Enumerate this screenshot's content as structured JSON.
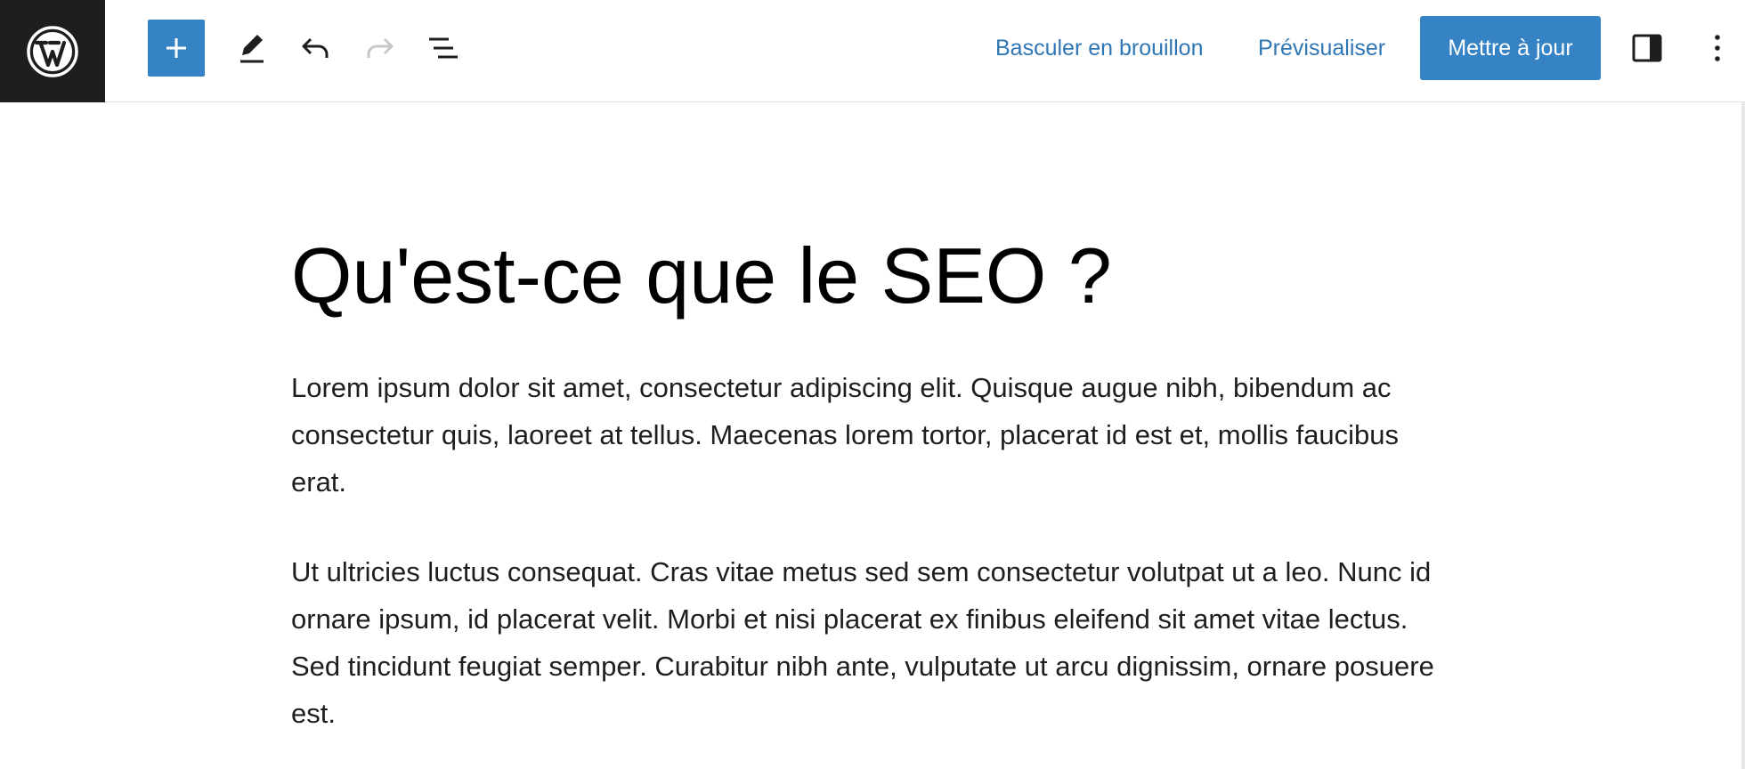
{
  "toolbar": {
    "add_block_label": "+",
    "switch_to_draft": "Basculer en brouillon",
    "preview": "Prévisualiser",
    "update": "Mettre à jour"
  },
  "icons": {
    "logo": "wordpress-logo",
    "add": "plus-icon",
    "tools": "pencil-icon",
    "undo": "undo-icon",
    "redo": "redo-icon",
    "list_view": "list-view-icon",
    "settings": "sidebar-toggle-icon",
    "options": "more-vertical-icon"
  },
  "colors": {
    "accent": "#3582c4",
    "link": "#2f76b5",
    "logo_bg": "#1e1e1e",
    "disabled": "#c7c7c7"
  },
  "post": {
    "title": "Qu'est-ce que le SEO ?",
    "paragraphs": [
      "Lorem ipsum dolor sit amet, consectetur adipiscing elit. Quisque augue nibh, bibendum ac consectetur quis, laoreet at tellus. Maecenas lorem tortor, placerat id est et, mollis faucibus erat.",
      "Ut ultricies luctus consequat. Cras vitae metus sed sem consectetur volutpat ut a leo. Nunc id ornare ipsum, id placerat velit. Morbi et nisi placerat ex finibus eleifend sit amet vitae lectus. Sed tincidunt feugiat semper. Curabitur nibh ante, vulputate ut arcu dignissim, ornare posuere est."
    ]
  }
}
